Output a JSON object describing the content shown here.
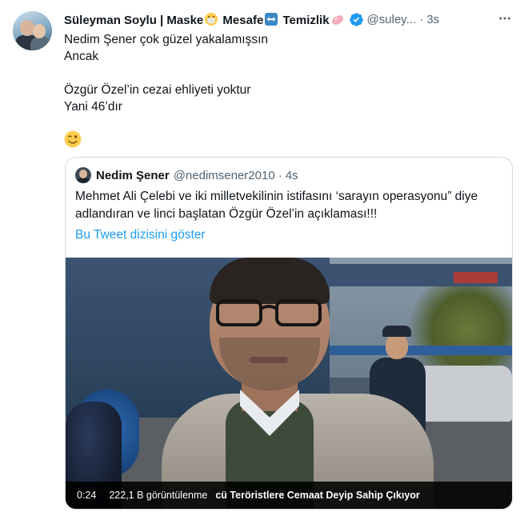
{
  "tweet": {
    "display_name": "Süleyman Soylu | Maske",
    "name_part2": " Mesafe",
    "name_part3": " Temizlik",
    "handle": "@suley...",
    "separator": "·",
    "time": "3s",
    "lines": [
      "Nedim Şener çok güzel yakalamışsın",
      "Ancak",
      "",
      "Özgür Özel’in cezai ehliyeti yoktur",
      "Yani 46’dır"
    ],
    "emoji": "wink-face-emoji"
  },
  "quote": {
    "display_name": "Nedim Şener",
    "handle": "@nedimsener2010",
    "separator": "·",
    "time": "4s",
    "text": "Mehmet Ali Çelebi ve iki milletvekilinin istifasını ‘sarayın operasyonu” diye adlandıran ve linci başlatan Özgür Özel’in açıklaması!!!",
    "thread_link": "Bu Tweet dizisini göster"
  },
  "video": {
    "duration": "0:24",
    "views": "222,1 B görüntülenme",
    "caption": "cü Teröristlere Cemaat Deyip Sahip Çıkıyor"
  },
  "colors": {
    "text": "#0f1419",
    "secondary": "#536471",
    "accent": "#1d9bf0",
    "border": "#cfd9de"
  }
}
